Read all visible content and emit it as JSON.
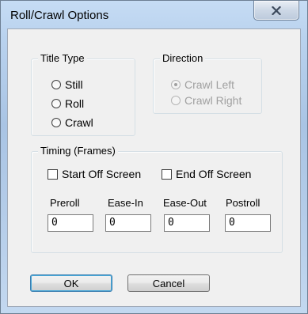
{
  "window": {
    "title": "Roll/Crawl Options",
    "close_icon": "close-x-icon"
  },
  "title_type": {
    "legend": "Title Type",
    "options": [
      {
        "label": "Still",
        "selected": false
      },
      {
        "label": "Roll",
        "selected": false
      },
      {
        "label": "Crawl",
        "selected": false
      }
    ]
  },
  "direction": {
    "legend": "Direction",
    "enabled": false,
    "options": [
      {
        "label": "Crawl Left",
        "selected": true
      },
      {
        "label": "Crawl Right",
        "selected": false
      }
    ]
  },
  "timing": {
    "legend": "Timing (Frames)",
    "start_off_screen": {
      "label": "Start Off Screen",
      "checked": false
    },
    "end_off_screen": {
      "label": "End Off Screen",
      "checked": false
    },
    "fields": [
      {
        "label": "Preroll",
        "value": "0"
      },
      {
        "label": "Ease-In",
        "value": "0"
      },
      {
        "label": "Ease-Out",
        "value": "0"
      },
      {
        "label": "Postroll",
        "value": "0"
      }
    ]
  },
  "buttons": {
    "ok_label": "OK",
    "cancel_label": "Cancel"
  }
}
